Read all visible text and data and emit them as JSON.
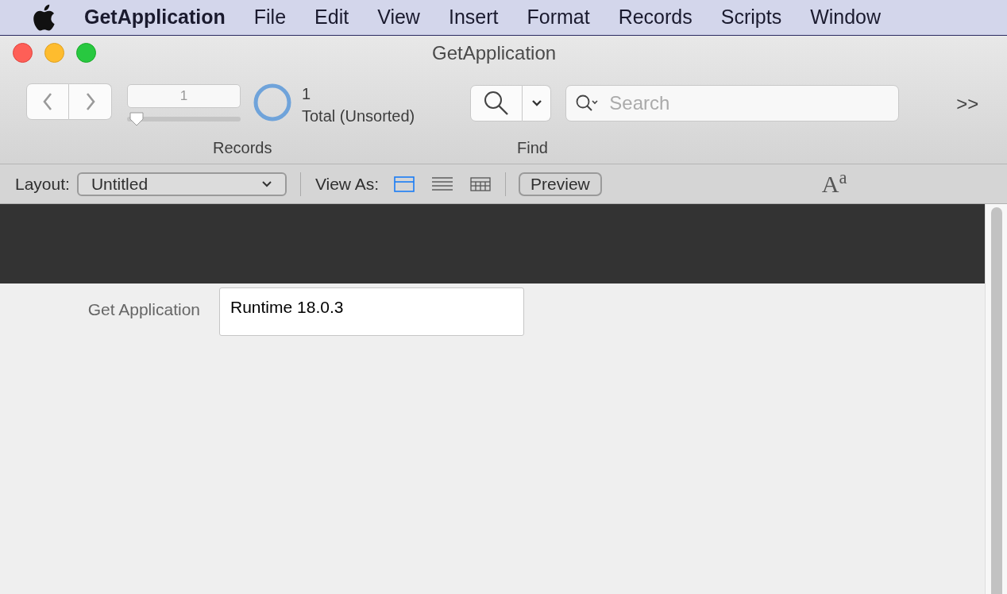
{
  "menu_bar": {
    "app": "GetApplication",
    "items": [
      "File",
      "Edit",
      "View",
      "Insert",
      "Format",
      "Records",
      "Scripts",
      "Window"
    ]
  },
  "window": {
    "title": "GetApplication"
  },
  "toolbar": {
    "record_field": "1",
    "record_slider": {
      "level": 0.03
    },
    "found_count": "1",
    "total_label": "Total (Unsorted)",
    "records_label": "Records",
    "find_label": "Find",
    "search": {
      "placeholder": "Search"
    },
    "overflow": ">>"
  },
  "layout_bar": {
    "layout_label": "Layout:",
    "layout_value": "Untitled",
    "view_as_label": "View As:",
    "view_as": [
      {
        "kind": "form",
        "selected": true
      },
      {
        "kind": "list",
        "selected": false
      },
      {
        "kind": "table",
        "selected": false
      }
    ],
    "preview": "Preview",
    "text_format": "A$^{a}$"
  },
  "form": {
    "fields": [
      {
        "label": "Get Application",
        "value": "Runtime 18.0.3"
      }
    ]
  }
}
